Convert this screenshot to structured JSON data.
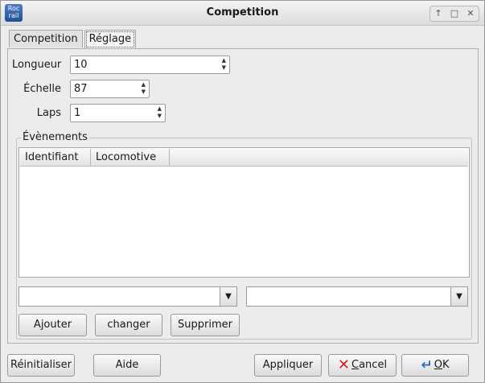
{
  "window": {
    "title": "Competition",
    "icon_text_1": "Roc",
    "icon_text_2": "rail"
  },
  "tabs": [
    {
      "label": "Competition"
    },
    {
      "label": "Réglage"
    }
  ],
  "settings": {
    "length_label": "Longueur",
    "length_value": "10",
    "scale_label": "Échelle",
    "scale_value": "87",
    "laps_label": "Laps",
    "laps_value": "1"
  },
  "events": {
    "group_label": "Évènements",
    "columns": [
      "Identifiant",
      "Locomotive",
      ""
    ],
    "rows": []
  },
  "event_actions": {
    "add": "Ajouter",
    "change": "changer",
    "delete": "Supprimer"
  },
  "footer": {
    "reset": "Réinitialiser",
    "help": "Aide",
    "apply": "Appliquer",
    "cancel_first": "C",
    "cancel_rest": "ancel",
    "ok_first": "O",
    "ok_rest": "K"
  },
  "colors": {
    "accent": "#2a6fc9",
    "cancel": "#d42020"
  }
}
